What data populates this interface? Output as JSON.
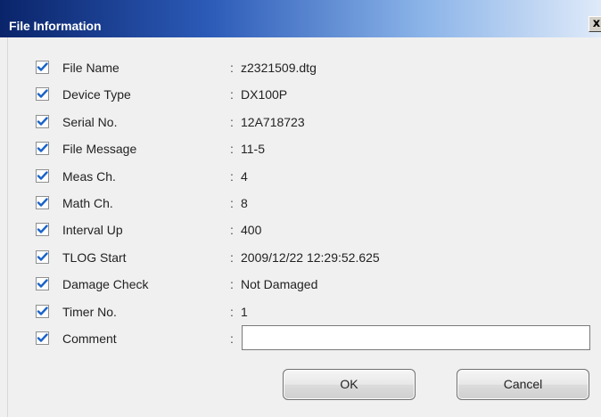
{
  "window": {
    "title": "File Information",
    "close_label": "x"
  },
  "fields": [
    {
      "label": "File Name",
      "value": "z2321509.dtg",
      "checked": true
    },
    {
      "label": "Device Type",
      "value": "DX100P",
      "checked": true
    },
    {
      "label": "Serial No.",
      "value": "12A718723",
      "checked": true
    },
    {
      "label": "File Message",
      "value": "11-5",
      "checked": true
    },
    {
      "label": "Meas Ch.",
      "value": "4",
      "checked": true
    },
    {
      "label": "Math Ch.",
      "value": "8",
      "checked": true
    },
    {
      "label": "Interval Up",
      "value": "400",
      "checked": true
    },
    {
      "label": "TLOG Start",
      "value": "2009/12/22 12:29:52.625",
      "checked": true
    },
    {
      "label": "Damage Check",
      "value": "Not Damaged",
      "checked": true
    },
    {
      "label": "Timer No.",
      "value": "1",
      "checked": true
    }
  ],
  "comment": {
    "label": "Comment",
    "value": "",
    "checked": true
  },
  "separator": ":",
  "buttons": {
    "ok_label": "OK",
    "cancel_label": "Cancel"
  },
  "colors": {
    "title_start": "#0a246a",
    "title_end": "#dfeaf9",
    "check_mark": "#1a63c8"
  },
  "icons": {
    "checkbox": "checkmark-icon",
    "close": "close-icon"
  }
}
